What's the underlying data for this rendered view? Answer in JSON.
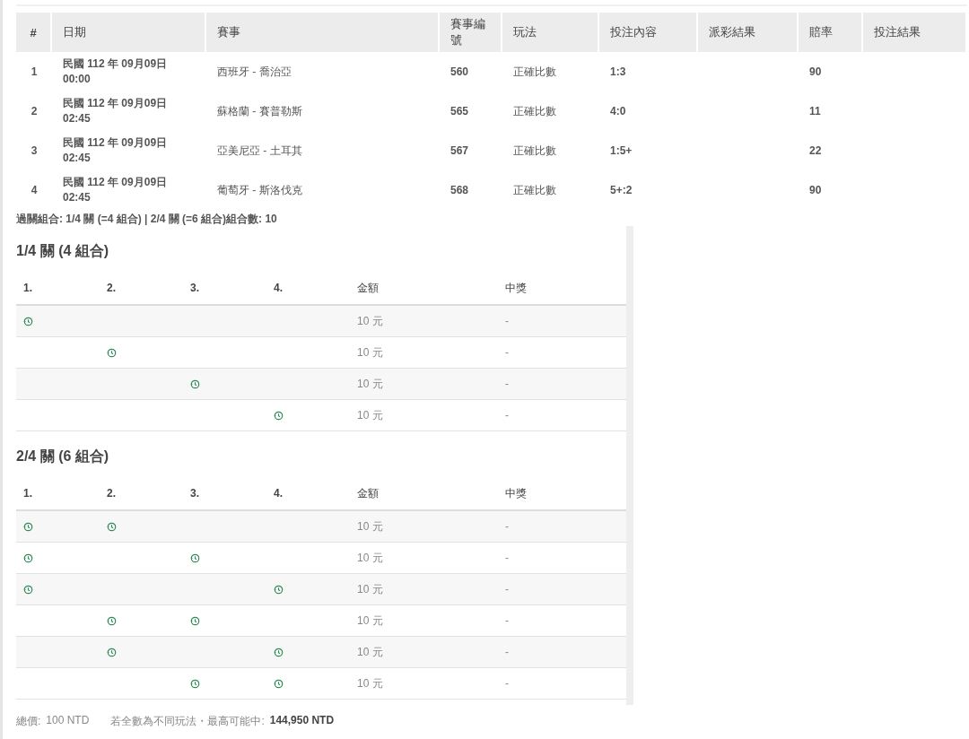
{
  "bets_table": {
    "columns": [
      "#",
      "日期",
      "賽事",
      "賽事編號",
      "玩法",
      "投注內容",
      "派彩結果",
      "賠率",
      "投注結果"
    ],
    "rows": [
      {
        "index": "1",
        "date": "民國 112 年 09月09日",
        "time": "00:00",
        "match": "西班牙 - 喬治亞",
        "match_no": "560",
        "play_type": "正確比數",
        "bet": "1:3",
        "odds": "90"
      },
      {
        "index": "2",
        "date": "民國 112 年 09月09日",
        "time": "02:45",
        "match": "蘇格蘭 - 賽普勒斯",
        "match_no": "565",
        "play_type": "正確比數",
        "bet": "4:0",
        "odds": "11"
      },
      {
        "index": "3",
        "date": "民國 112 年 09月09日",
        "time": "02:45",
        "match": "亞美尼亞 - 土耳其",
        "match_no": "567",
        "play_type": "正確比數",
        "bet": "1:5+",
        "odds": "22"
      },
      {
        "index": "4",
        "date": "民國 112 年 09月09日",
        "time": "02:45",
        "match": "葡萄牙 - 斯洛伐克",
        "match_no": "568",
        "play_type": "正確比數",
        "bet": "5+:2",
        "odds": "90"
      }
    ]
  },
  "summary": "過關組合: 1/4 關 (=4 組合) | 2/4 關 (=6 組合)組合數: 10",
  "sections": [
    {
      "title": "1/4 關 (4 組合)",
      "columns": [
        "1.",
        "2.",
        "3.",
        "4.",
        "金額",
        "中獎"
      ],
      "rows": [
        {
          "legs": [
            true,
            false,
            false,
            false
          ],
          "amount": "10 元",
          "prize": "-"
        },
        {
          "legs": [
            false,
            true,
            false,
            false
          ],
          "amount": "10 元",
          "prize": "-"
        },
        {
          "legs": [
            false,
            false,
            true,
            false
          ],
          "amount": "10 元",
          "prize": "-"
        },
        {
          "legs": [
            false,
            false,
            false,
            true
          ],
          "amount": "10 元",
          "prize": "-"
        }
      ]
    },
    {
      "title": "2/4 關 (6 組合)",
      "columns": [
        "1.",
        "2.",
        "3.",
        "4.",
        "金額",
        "中獎"
      ],
      "rows": [
        {
          "legs": [
            true,
            true,
            false,
            false
          ],
          "amount": "10 元",
          "prize": "-"
        },
        {
          "legs": [
            true,
            false,
            true,
            false
          ],
          "amount": "10 元",
          "prize": "-"
        },
        {
          "legs": [
            true,
            false,
            false,
            true
          ],
          "amount": "10 元",
          "prize": "-"
        },
        {
          "legs": [
            false,
            true,
            true,
            false
          ],
          "amount": "10 元",
          "prize": "-"
        },
        {
          "legs": [
            false,
            true,
            false,
            true
          ],
          "amount": "10 元",
          "prize": "-"
        },
        {
          "legs": [
            false,
            false,
            true,
            true
          ],
          "amount": "10 元",
          "prize": "-"
        }
      ]
    }
  ],
  "footer": {
    "total_label": "總價:",
    "total": "100 NTD",
    "max_label": "若全數為不同玩法・最高可能中:",
    "max_win": "144,950 NTD"
  }
}
